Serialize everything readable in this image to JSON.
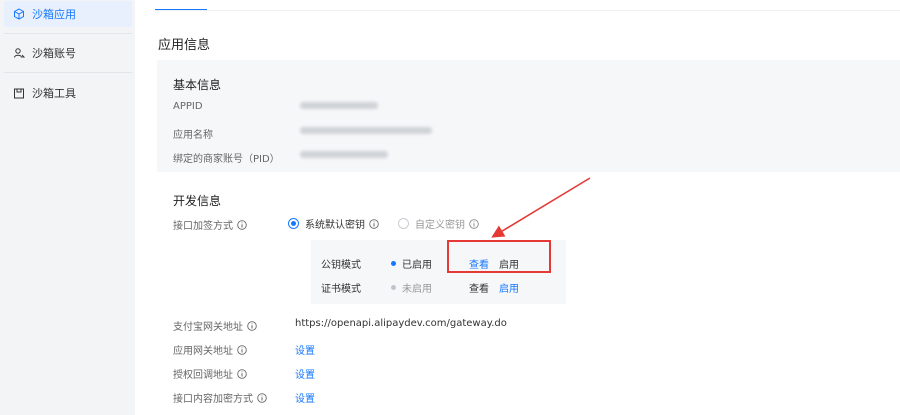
{
  "sidebar": {
    "items": [
      {
        "label": "沙箱应用",
        "icon": "cube-icon",
        "active": true
      },
      {
        "label": "沙箱账号",
        "icon": "users-icon",
        "active": false
      },
      {
        "label": "沙箱工具",
        "icon": "toolbox-icon",
        "active": false
      }
    ]
  },
  "main": {
    "section_title": "应用信息",
    "basic": {
      "title": "基本信息",
      "appid_label": "APPID",
      "appname_label": "应用名称",
      "pid_label": "绑定的商家账号（PID）"
    },
    "dev": {
      "title": "开发信息",
      "sign_label": "接口加签方式",
      "option_default": "系统默认密钥",
      "option_custom": "自定义密钥",
      "rows": [
        {
          "mode": "公钥模式",
          "status": "已启用",
          "view": "查看",
          "enable": "启用"
        },
        {
          "mode": "证书模式",
          "status": "未启用",
          "view": "查看",
          "enable": "启用"
        }
      ],
      "gateway_label": "支付宝网关地址",
      "gateway_value": "https://openapi.alipaydev.com/gateway.do",
      "app_gateway_label": "应用网关地址",
      "callback_label": "授权回调地址",
      "encrypt_label": "接口内容加密方式",
      "set_label": "设置"
    }
  },
  "colors": {
    "accent": "#1677ff",
    "highlight": "#e53935",
    "disabled_dot": "#c0c4cc"
  }
}
